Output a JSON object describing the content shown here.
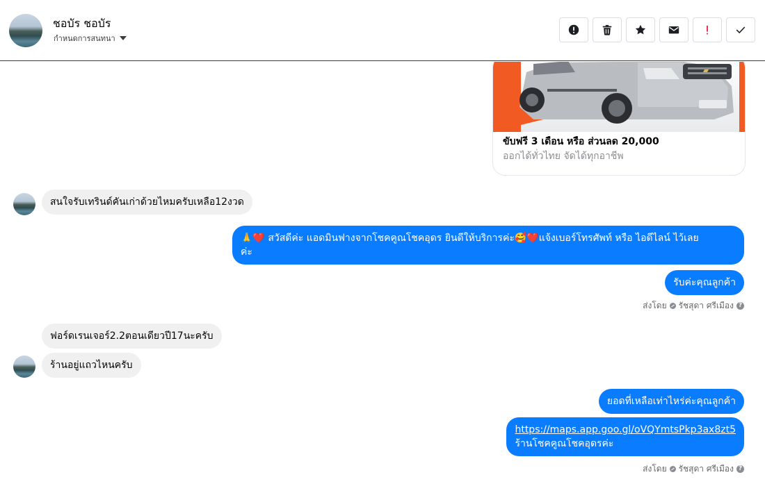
{
  "header": {
    "contact_name": "ชอบัร ชอบัร",
    "conversation_settings": "กำหนดการสนทนา"
  },
  "actions": [
    {
      "name": "spam-button",
      "icon": "alert-circle-icon"
    },
    {
      "name": "delete-button",
      "icon": "trash-icon"
    },
    {
      "name": "star-button",
      "icon": "star-icon"
    },
    {
      "name": "mark-unread-button",
      "icon": "envelope-icon"
    },
    {
      "name": "follow-up-button",
      "icon": "exclamation-icon"
    },
    {
      "name": "done-button",
      "icon": "check-icon"
    }
  ],
  "colors": {
    "outgoing_bubble": "#0a7cff",
    "incoming_bubble": "#f0f0f0",
    "follow_up_accent": "#e41e3f"
  },
  "ad_card": {
    "title": "ขับฟรี 3 เดือน หรือ ส่วนลด 20,000",
    "subtitle": "ออกได้ทั่วไทย จัดได้ทุกอาชีพ"
  },
  "messages": {
    "m1": "สนใจรับเทรินด์คันเก่าด้วยไหมครับเหลือ12งวด",
    "m2_line1": "🙏❤️ สวัสดีค่ะ แอดมินฟางจากโชคคูณโชคอุดร ยินดีให้บริการค่ะ🥰❤️แจ้งเบอร์โทรศัพท์ หรือ ไอดีไลน์  ไว้เลย",
    "m2_line2": "ค่ะ",
    "m3": "รับค่ะคุณลูกค้า",
    "m4": "ฟอร์ดเรนเจอร์2.2ตอนเดียวปี17นะครับ",
    "m5": "ร้านอยู่แถวไหนครับ",
    "m6": "ยอดที่เหลือเท่าไหร่ค่ะคุณลูกค้า",
    "m7_link": "https://maps.app.goo.gl/oVQYmtsPkp3ax8zt5",
    "m7_text": "ร้านโชคคูณโชคอุดรค่ะ"
  },
  "sent_by": {
    "label": "ส่งโดย",
    "agent": "รัชสุดา ศรีเมือง",
    "help": "?"
  }
}
